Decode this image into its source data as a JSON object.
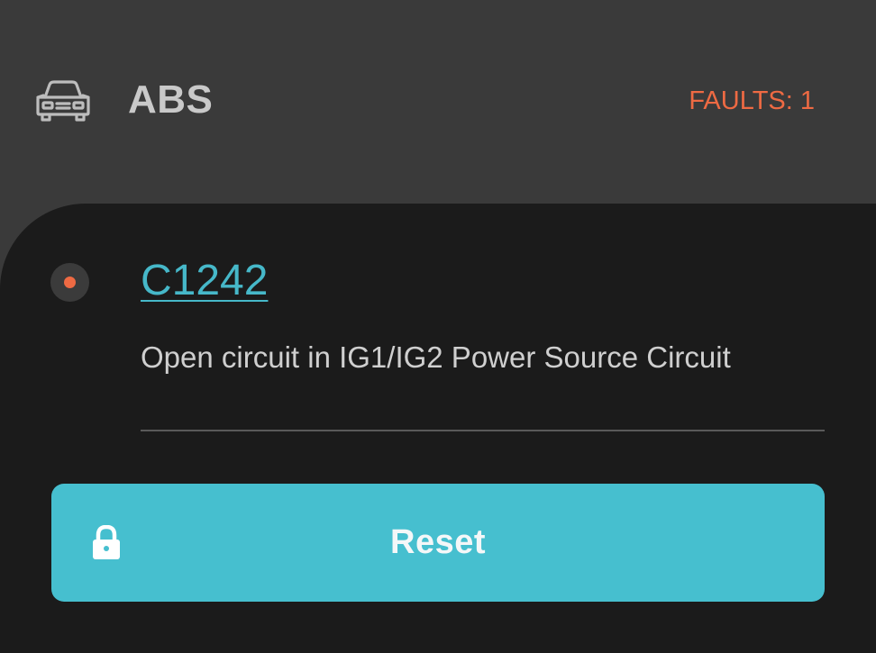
{
  "module": {
    "name": "ABS",
    "icon": "car-icon",
    "faults_label": "FAULTS: 1"
  },
  "fault": {
    "code": "C1242",
    "description": "Open circuit in IG1/IG2 Power Source Circuit",
    "status_icon": "status-dot-icon",
    "status_color": "#ee6a43"
  },
  "actions": {
    "reset_label": "Reset",
    "reset_icon": "lock-icon"
  },
  "colors": {
    "header_bg": "#3a3a3a",
    "panel_bg": "#1b1b1b",
    "accent": "#46bfcf",
    "link": "#46b8c9",
    "fault": "#ee6a43"
  }
}
